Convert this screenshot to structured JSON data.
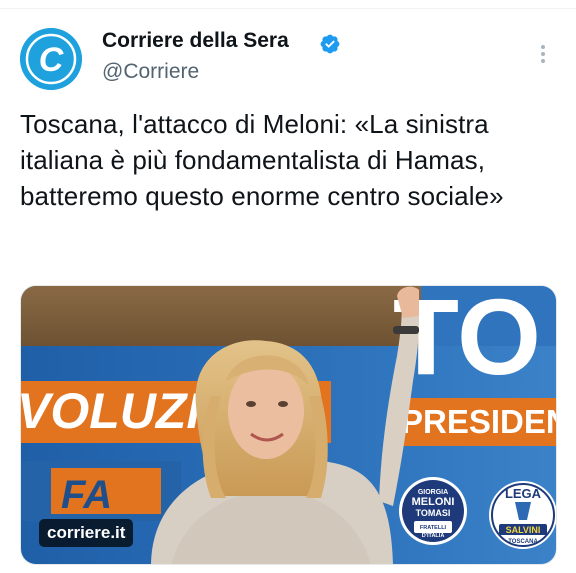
{
  "author": {
    "name": "Corriere della Sera",
    "handle": "@Corriere",
    "avatar_letter": "C",
    "verified": true,
    "brand_color": "#1fa1de",
    "verified_color": "#1d9bf0"
  },
  "tweet": {
    "text": "Toscana, l'attacco di Meloni: «La sinistra italiana è più fondamentalista di Hamas, batteremo questo enorme centro sociale»"
  },
  "media": {
    "link_badge": "corriere.it",
    "backdrop_texts": {
      "big_letters": "TO",
      "left_word": "VOLUZIO",
      "president": "PRESIDENT",
      "lower_left": "FA"
    },
    "logos": {
      "left": {
        "line1": "GIORGIA",
        "line2": "MELONI",
        "line3": "TOMASI",
        "line4": "FRATELLI",
        "line5": "D'ITALIA"
      },
      "right": {
        "line1": "LEGA",
        "line2": "SALVINI",
        "line3": "TOSCANA"
      }
    }
  },
  "icons": {
    "verified": "verified-badge-icon",
    "more": "more-options-icon"
  }
}
